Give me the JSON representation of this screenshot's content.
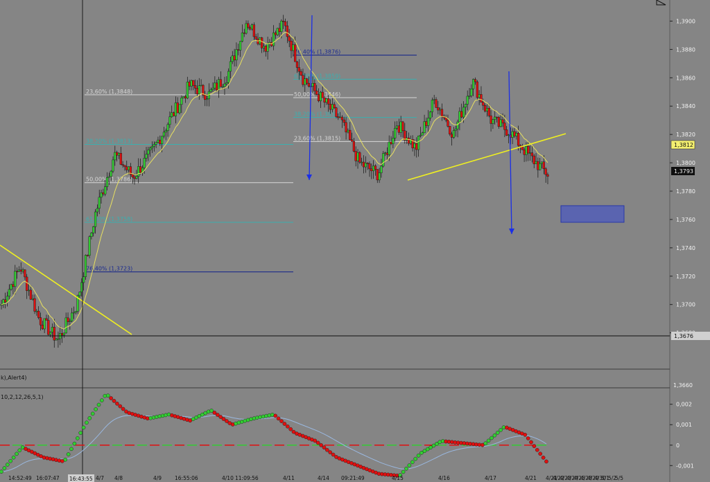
{
  "colors": {
    "background": "#858585",
    "bull": "#33cc33",
    "bear": "#e01010",
    "ma": "#e8e060",
    "trend": "#f0f020",
    "arrow": "#1a2ee8",
    "fib_light": "#d8d8d8",
    "fib_teal": "#3ab0b0",
    "fib_navy": "#10208a",
    "box": "#4a58b8",
    "cursor": "#101010",
    "label_price_bg": "#f4f070",
    "label_last_bg": "#101010"
  },
  "chart_data": [
    {
      "type": "candlestick",
      "title": "",
      "y_ticks": [
        "1,3900",
        "1,3880",
        "1,3860",
        "1,3840",
        "1,3820",
        "1,3800",
        "1,3780",
        "1,3760",
        "1,3740",
        "1,3720",
        "1,3700",
        "1,3680",
        "1,3660",
        "0"
      ],
      "ylim": [
        1.365,
        1.391
      ],
      "x_ticks": [
        "14:52:49",
        "16:07:47",
        "4/7",
        "4/8",
        "4/9",
        "16:55:06",
        "4/10",
        "11:09:56",
        "4/11",
        "4/14",
        "09:21:49",
        "4/15",
        "4/16",
        "4/17",
        "4/21",
        "4/21",
        "4/22",
        "4/23",
        "4/24",
        "4/25",
        "4/28",
        "4/29",
        "4/30",
        "5/1",
        "5/2",
        "5/5"
      ],
      "cursor_time": "16:43:55",
      "price_labels": {
        "current_ma": "1,3812",
        "last": "1,3793",
        "cursor_level": "1,3676"
      },
      "fib_left": [
        {
          "label": "23,60% (1,3848)",
          "value": 1.3848
        },
        {
          "label": "38,20% (1,3813)",
          "value": 1.3813
        },
        {
          "label": "50,00% (1,3786)",
          "value": 1.3786
        },
        {
          "label": "61,80% (1,3758)",
          "value": 1.3758
        },
        {
          "label": "76,40% (1,3723)",
          "value": 1.3723
        }
      ],
      "fib_right": [
        {
          "label": "76,40% (1,3876)",
          "value": 1.3876
        },
        {
          "label": "61,80% (1,3859)",
          "value": 1.3859
        },
        {
          "label": "50,00% (1,3846)",
          "value": 1.3846
        },
        {
          "label": "38,20% (1,3832)",
          "value": 1.3832
        },
        {
          "label": "23,60% (1,3815)",
          "value": 1.3815
        }
      ],
      "swing_points": [
        1.37,
        1.3727,
        1.369,
        1.3675,
        1.37,
        1.3765,
        1.3806,
        1.379,
        1.3808,
        1.3832,
        1.3855,
        1.3848,
        1.3862,
        1.39,
        1.3882,
        1.3898,
        1.386,
        1.3845,
        1.383,
        1.38,
        1.3792,
        1.3828,
        1.381,
        1.3845,
        1.382,
        1.3858,
        1.383,
        1.3822,
        1.3805,
        1.3792
      ],
      "candle_count": 280
    },
    {
      "type": "line",
      "title": "",
      "indicator_label_top": "k),Alert4)",
      "indicator_label": "10,2,12,26,5,1)",
      "y_ticks": [
        "0,002",
        "0,001",
        "0",
        "-0,001"
      ],
      "ylim": [
        -0.0016,
        0.0026
      ],
      "series_points": [
        -0.0013,
        -0.0001,
        -0.0006,
        -0.0008,
        0.001,
        0.0025,
        0.0016,
        0.0013,
        0.0015,
        0.0012,
        0.0017,
        0.001,
        0.0013,
        0.0015,
        0.0006,
        0.0002,
        -0.0006,
        -0.001,
        -0.0014,
        -0.0015,
        -0.0004,
        0.0002,
        0.0001,
        0.0,
        0.0009,
        0.0005,
        -0.0008
      ]
    }
  ]
}
